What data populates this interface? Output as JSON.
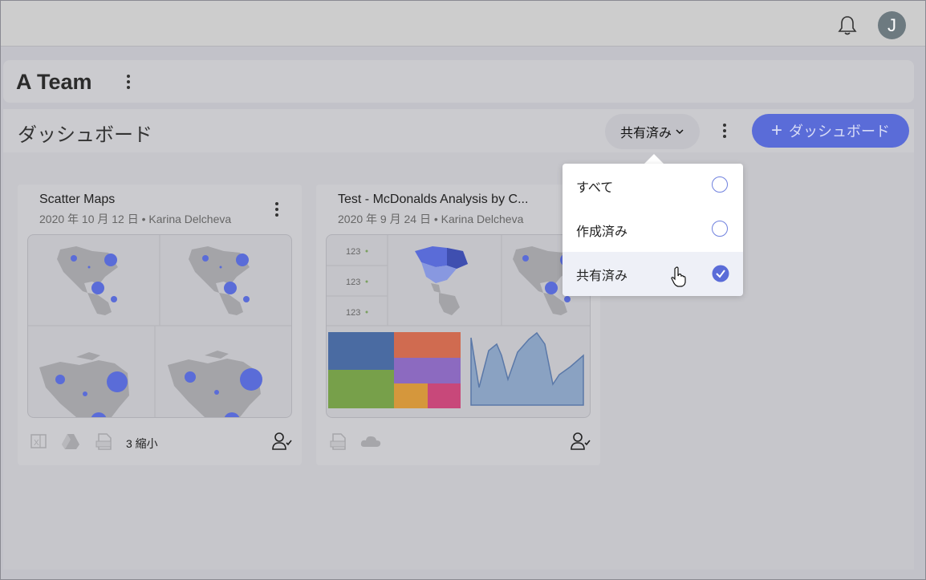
{
  "header": {
    "bell_icon": "bell-icon",
    "avatar_letter": "J"
  },
  "team": {
    "title": "A Team"
  },
  "dashboards": {
    "title": "ダッシュボード",
    "filter_label": "共有済み",
    "add_button_label": "ダッシュボード"
  },
  "cards": [
    {
      "title": "Scatter Maps",
      "subtitle": "2020 年 10 月 12 日 • Karina Delcheva",
      "footer_text": "3 縮小",
      "sources": [
        "excel-icon",
        "google-drive-icon",
        "csv-icon"
      ]
    },
    {
      "title": "Test - McDonalds Analysis by C...",
      "subtitle": "2020 年 9 月 24 日 • Karina Delcheva",
      "kpi_values": [
        "123",
        "123",
        "123"
      ],
      "sources": [
        "csv-icon",
        "cloud-icon"
      ]
    }
  ],
  "filter_dropdown": {
    "options": [
      {
        "label": "すべて",
        "selected": false
      },
      {
        "label": "作成済み",
        "selected": false
      },
      {
        "label": "共有済み",
        "selected": true
      }
    ]
  },
  "colors": {
    "accent": "#5a6cd8",
    "radio": "#6f80de",
    "map_dot": "#5a6cd8"
  }
}
